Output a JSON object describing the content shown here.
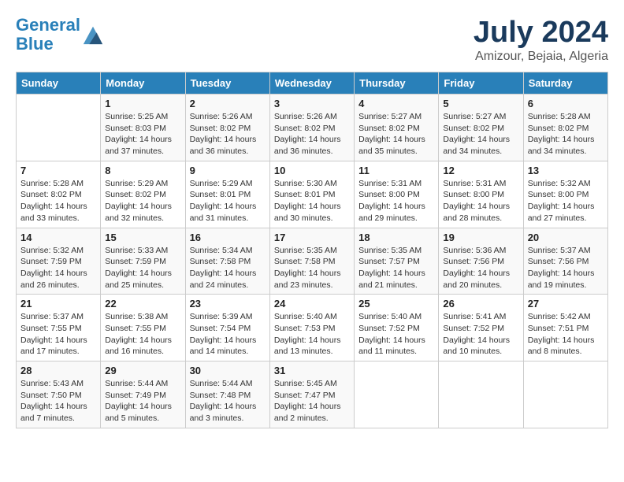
{
  "header": {
    "logo_line1": "General",
    "logo_line2": "Blue",
    "title": "July 2024",
    "subtitle": "Amizour, Bejaia, Algeria"
  },
  "days_of_week": [
    "Sunday",
    "Monday",
    "Tuesday",
    "Wednesday",
    "Thursday",
    "Friday",
    "Saturday"
  ],
  "weeks": [
    [
      {
        "day": "",
        "info": ""
      },
      {
        "day": "1",
        "info": "Sunrise: 5:25 AM\nSunset: 8:03 PM\nDaylight: 14 hours\nand 37 minutes."
      },
      {
        "day": "2",
        "info": "Sunrise: 5:26 AM\nSunset: 8:02 PM\nDaylight: 14 hours\nand 36 minutes."
      },
      {
        "day": "3",
        "info": "Sunrise: 5:26 AM\nSunset: 8:02 PM\nDaylight: 14 hours\nand 36 minutes."
      },
      {
        "day": "4",
        "info": "Sunrise: 5:27 AM\nSunset: 8:02 PM\nDaylight: 14 hours\nand 35 minutes."
      },
      {
        "day": "5",
        "info": "Sunrise: 5:27 AM\nSunset: 8:02 PM\nDaylight: 14 hours\nand 34 minutes."
      },
      {
        "day": "6",
        "info": "Sunrise: 5:28 AM\nSunset: 8:02 PM\nDaylight: 14 hours\nand 34 minutes."
      }
    ],
    [
      {
        "day": "7",
        "info": "Sunrise: 5:28 AM\nSunset: 8:02 PM\nDaylight: 14 hours\nand 33 minutes."
      },
      {
        "day": "8",
        "info": "Sunrise: 5:29 AM\nSunset: 8:02 PM\nDaylight: 14 hours\nand 32 minutes."
      },
      {
        "day": "9",
        "info": "Sunrise: 5:29 AM\nSunset: 8:01 PM\nDaylight: 14 hours\nand 31 minutes."
      },
      {
        "day": "10",
        "info": "Sunrise: 5:30 AM\nSunset: 8:01 PM\nDaylight: 14 hours\nand 30 minutes."
      },
      {
        "day": "11",
        "info": "Sunrise: 5:31 AM\nSunset: 8:00 PM\nDaylight: 14 hours\nand 29 minutes."
      },
      {
        "day": "12",
        "info": "Sunrise: 5:31 AM\nSunset: 8:00 PM\nDaylight: 14 hours\nand 28 minutes."
      },
      {
        "day": "13",
        "info": "Sunrise: 5:32 AM\nSunset: 8:00 PM\nDaylight: 14 hours\nand 27 minutes."
      }
    ],
    [
      {
        "day": "14",
        "info": "Sunrise: 5:32 AM\nSunset: 7:59 PM\nDaylight: 14 hours\nand 26 minutes."
      },
      {
        "day": "15",
        "info": "Sunrise: 5:33 AM\nSunset: 7:59 PM\nDaylight: 14 hours\nand 25 minutes."
      },
      {
        "day": "16",
        "info": "Sunrise: 5:34 AM\nSunset: 7:58 PM\nDaylight: 14 hours\nand 24 minutes."
      },
      {
        "day": "17",
        "info": "Sunrise: 5:35 AM\nSunset: 7:58 PM\nDaylight: 14 hours\nand 23 minutes."
      },
      {
        "day": "18",
        "info": "Sunrise: 5:35 AM\nSunset: 7:57 PM\nDaylight: 14 hours\nand 21 minutes."
      },
      {
        "day": "19",
        "info": "Sunrise: 5:36 AM\nSunset: 7:56 PM\nDaylight: 14 hours\nand 20 minutes."
      },
      {
        "day": "20",
        "info": "Sunrise: 5:37 AM\nSunset: 7:56 PM\nDaylight: 14 hours\nand 19 minutes."
      }
    ],
    [
      {
        "day": "21",
        "info": "Sunrise: 5:37 AM\nSunset: 7:55 PM\nDaylight: 14 hours\nand 17 minutes."
      },
      {
        "day": "22",
        "info": "Sunrise: 5:38 AM\nSunset: 7:55 PM\nDaylight: 14 hours\nand 16 minutes."
      },
      {
        "day": "23",
        "info": "Sunrise: 5:39 AM\nSunset: 7:54 PM\nDaylight: 14 hours\nand 14 minutes."
      },
      {
        "day": "24",
        "info": "Sunrise: 5:40 AM\nSunset: 7:53 PM\nDaylight: 14 hours\nand 13 minutes."
      },
      {
        "day": "25",
        "info": "Sunrise: 5:40 AM\nSunset: 7:52 PM\nDaylight: 14 hours\nand 11 minutes."
      },
      {
        "day": "26",
        "info": "Sunrise: 5:41 AM\nSunset: 7:52 PM\nDaylight: 14 hours\nand 10 minutes."
      },
      {
        "day": "27",
        "info": "Sunrise: 5:42 AM\nSunset: 7:51 PM\nDaylight: 14 hours\nand 8 minutes."
      }
    ],
    [
      {
        "day": "28",
        "info": "Sunrise: 5:43 AM\nSunset: 7:50 PM\nDaylight: 14 hours\nand 7 minutes."
      },
      {
        "day": "29",
        "info": "Sunrise: 5:44 AM\nSunset: 7:49 PM\nDaylight: 14 hours\nand 5 minutes."
      },
      {
        "day": "30",
        "info": "Sunrise: 5:44 AM\nSunset: 7:48 PM\nDaylight: 14 hours\nand 3 minutes."
      },
      {
        "day": "31",
        "info": "Sunrise: 5:45 AM\nSunset: 7:47 PM\nDaylight: 14 hours\nand 2 minutes."
      },
      {
        "day": "",
        "info": ""
      },
      {
        "day": "",
        "info": ""
      },
      {
        "day": "",
        "info": ""
      }
    ]
  ]
}
